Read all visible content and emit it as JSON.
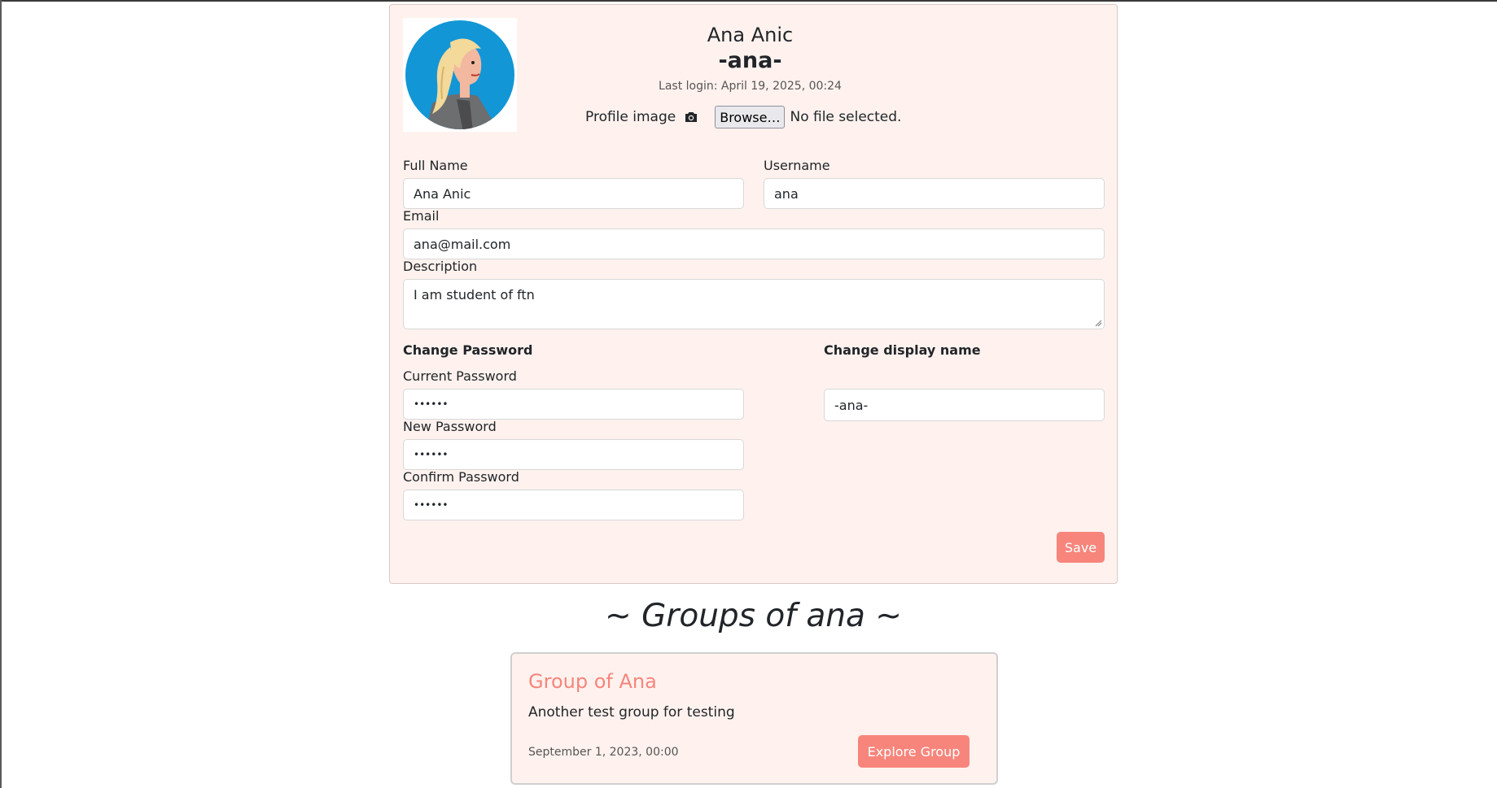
{
  "profile": {
    "full_name_title": "Ana Anic",
    "display_name_title": "-ana-",
    "last_login": "Last login: April 19, 2025, 00:24",
    "profile_image_label": "Profile image",
    "browse_label": "Browse…",
    "no_file_text": "No file selected.",
    "camera_icon": "camera-icon",
    "avatar_icon": "avatar-illustration"
  },
  "form": {
    "full_name_label": "Full Name",
    "full_name_value": "Ana Anic",
    "username_label": "Username",
    "username_value": "ana",
    "email_label": "Email",
    "email_value": "ana@mail.com",
    "description_label": "Description",
    "description_value": "I am student of ftn",
    "change_password_heading": "Change Password",
    "current_password_label": "Current Password",
    "current_password_value": "••••••",
    "new_password_label": "New Password",
    "new_password_value": "••••••",
    "confirm_password_label": "Confirm Password",
    "confirm_password_value": "••••••",
    "change_display_name_heading": "Change display name",
    "display_name_value": "-ana-",
    "save_label": "Save"
  },
  "groups": {
    "heading": "~ Groups of ana ~",
    "items": [
      {
        "title": "Group of Ana",
        "description": "Another test group for testing",
        "date": "September 1, 2023, 00:00",
        "button_label": "Explore Group"
      }
    ]
  },
  "colors": {
    "accent": "#f7857c",
    "card_background": "#fff2ee",
    "avatar_background": "#1296d6"
  }
}
